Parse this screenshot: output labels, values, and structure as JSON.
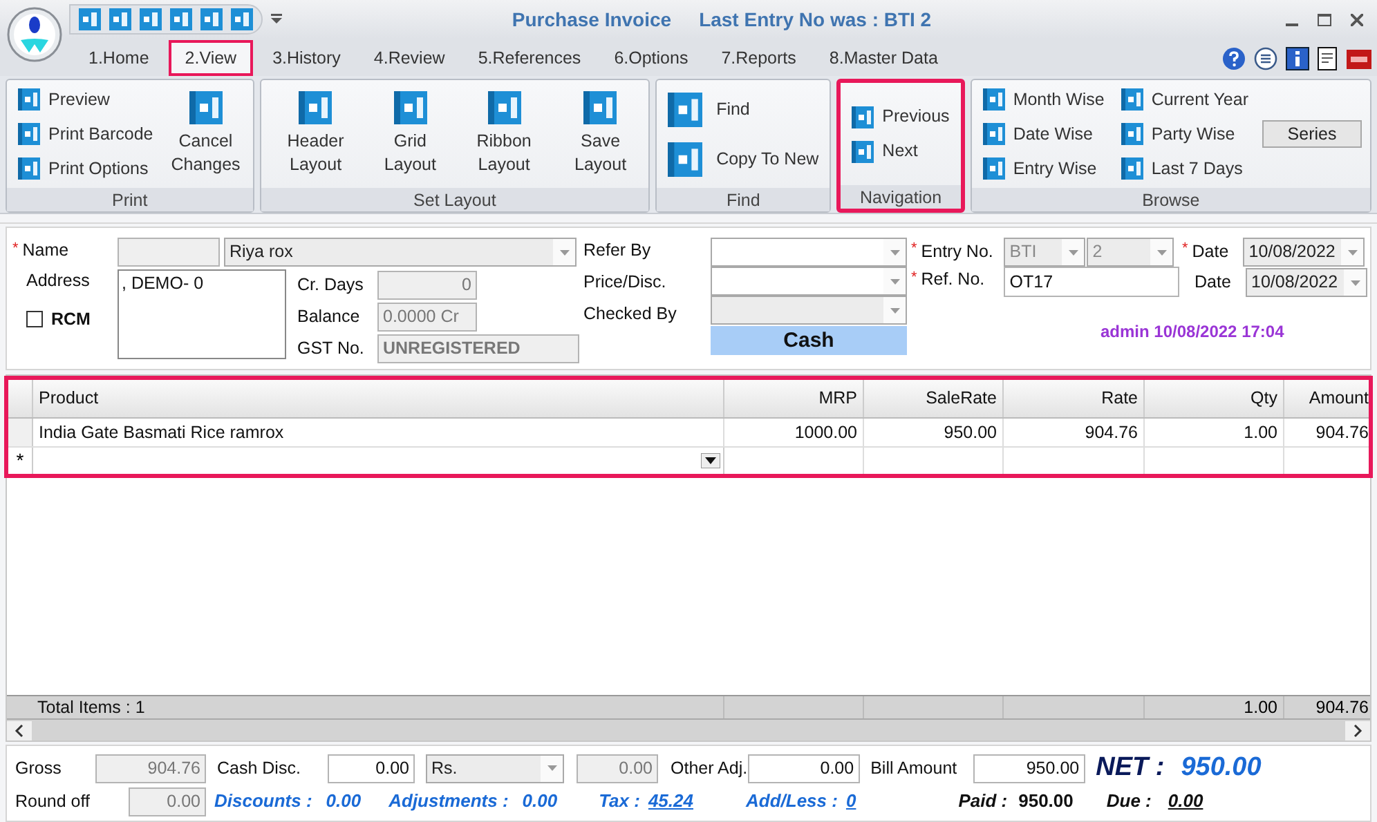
{
  "window": {
    "title": "Purchase Invoice",
    "subtitle": "Last Entry No was : BTI 2"
  },
  "tabs": [
    {
      "label": "1.Home",
      "selected": false
    },
    {
      "label": "2.View",
      "selected": true
    },
    {
      "label": "3.History",
      "selected": false
    },
    {
      "label": "4.Review",
      "selected": false
    },
    {
      "label": "5.References",
      "selected": false
    },
    {
      "label": "6.Options",
      "selected": false
    },
    {
      "label": "7.Reports",
      "selected": false
    },
    {
      "label": "8.Master Data",
      "selected": false
    }
  ],
  "ribbon": [
    {
      "title": "Print",
      "highlighted": false,
      "columns": [
        [
          {
            "kind": "small",
            "label": "Preview"
          },
          {
            "kind": "small",
            "label": "Print Barcode"
          },
          {
            "kind": "small",
            "label": "Print Options"
          }
        ],
        [
          {
            "kind": "large",
            "label": "Cancel Changes"
          }
        ]
      ]
    },
    {
      "title": "Set Layout",
      "highlighted": false,
      "columns": [
        [
          {
            "kind": "large",
            "label": "Header Layout"
          }
        ],
        [
          {
            "kind": "large",
            "label": "Grid Layout"
          }
        ],
        [
          {
            "kind": "large",
            "label": "Ribbon Layout"
          }
        ],
        [
          {
            "kind": "large",
            "label": "Save Layout"
          }
        ]
      ]
    },
    {
      "title": "Find",
      "highlighted": false,
      "columns": [
        [
          {
            "kind": "medium",
            "label": "Find"
          },
          {
            "kind": "medium",
            "label": "Copy To New"
          }
        ]
      ]
    },
    {
      "title": "Navigation",
      "highlighted": true,
      "columns": [
        [
          {
            "kind": "small",
            "label": "Previous"
          },
          {
            "kind": "small",
            "label": "Next"
          }
        ]
      ]
    },
    {
      "title": "Browse",
      "highlighted": false,
      "columns": [
        [
          {
            "kind": "small",
            "label": "Month Wise"
          },
          {
            "kind": "small",
            "label": "Date Wise"
          },
          {
            "kind": "small",
            "label": "Entry Wise"
          }
        ],
        [
          {
            "kind": "small",
            "label": "Current Year"
          },
          {
            "kind": "small",
            "label": "Party Wise"
          },
          {
            "kind": "small",
            "label": "Last 7 Days"
          }
        ],
        [
          {
            "kind": "button",
            "label": "Series"
          }
        ]
      ]
    }
  ],
  "form": {
    "name": {
      "label": "Name",
      "required": true,
      "value": "Riya rox"
    },
    "address": {
      "label": "Address",
      "value": ", DEMO- 0"
    },
    "rcm": {
      "label": "RCM",
      "checked": false
    },
    "cr_days": {
      "label": "Cr. Days",
      "value": "0"
    },
    "balance": {
      "label": "Balance",
      "value": "0.0000 Cr"
    },
    "gst_no": {
      "label": "GST No.",
      "value": "UNREGISTERED"
    },
    "refer_by": {
      "label": "Refer By"
    },
    "price_disc": {
      "label": "Price/Disc."
    },
    "checked_by": {
      "label": "Checked By"
    },
    "payment_mode": "Cash",
    "entry_no": {
      "label": "Entry No.",
      "required": true,
      "series": "BTI",
      "number": "2"
    },
    "ref_no": {
      "label": "Ref. No.",
      "required": true,
      "value": "OT17"
    },
    "date": {
      "label": "Date",
      "required": true,
      "value": "10/08/2022"
    },
    "date_2": {
      "label": "Date",
      "value": "10/08/2022"
    },
    "audit": "admin 10/08/2022 17:04"
  },
  "grid": {
    "highlighted": true,
    "columns": [
      "Product",
      "MRP",
      "SaleRate",
      "Rate",
      "Qty",
      "Amount"
    ],
    "rows": [
      [
        "India Gate Basmati Rice ramrox",
        "1000.00",
        "950.00",
        "904.76",
        "1.00",
        "904.76"
      ]
    ],
    "new_row_marker": "*",
    "totals": {
      "label": "Total Items : 1",
      "qty": "1.00",
      "amount": "904.76"
    }
  },
  "footer": {
    "gross": {
      "label": "Gross",
      "value": "904.76"
    },
    "cash_disc": {
      "label": "Cash Disc.",
      "value": "0.00",
      "unit": "Rs.",
      "amount": "0.00"
    },
    "other_adj": {
      "label": "Other Adj.",
      "value": "0.00"
    },
    "bill_amount": {
      "label": "Bill Amount",
      "value": "950.00"
    },
    "net": {
      "label": "NET :",
      "value": "950.00"
    },
    "round_off": {
      "label": "Round off",
      "value": "0.00"
    },
    "discounts": {
      "label": "Discounts :",
      "value": "0.00"
    },
    "adjustments": {
      "label": "Adjustments :",
      "value": "0.00"
    },
    "tax": {
      "label": "Tax :",
      "value": "45.24"
    },
    "add_less": {
      "label": "Add/Less :",
      "value": "0"
    },
    "paid": {
      "label": "Paid :",
      "value": "950.00"
    },
    "due": {
      "label": "Due :",
      "value": "0.00"
    }
  }
}
